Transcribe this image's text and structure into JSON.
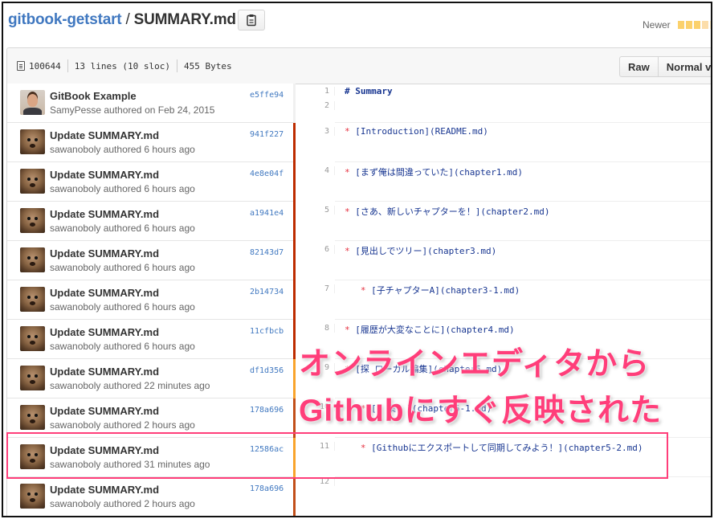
{
  "header": {
    "repo": "gitbook-getstart",
    "sep": " / ",
    "file": "SUMMARY.md",
    "newer": "Newer",
    "legend_colors": [
      "#fbd16c",
      "#fbd16c",
      "#fbd16c",
      "#fcddaa",
      "#fff0cc"
    ]
  },
  "filebar": {
    "mode": "100644",
    "lines": "13 lines (10 sloc)",
    "size": "455 Bytes",
    "raw_label": "Raw",
    "normal_label": "Normal view"
  },
  "commits": [
    {
      "msg": "GitBook Example",
      "author": "SamyPesse authored on Feb 24, 2015",
      "sha": "e5ffe94",
      "avatar": "person",
      "age_color": "#f0f0f0"
    },
    {
      "msg": "Update SUMMARY.md",
      "author": "sawanoboly authored 6 hours ago",
      "sha": "941f227",
      "avatar": "dog",
      "age_color": "#bd2c00"
    },
    {
      "msg": "Update SUMMARY.md",
      "author": "sawanoboly authored 6 hours ago",
      "sha": "4e8e04f",
      "avatar": "dog",
      "age_color": "#bd2c00"
    },
    {
      "msg": "Update SUMMARY.md",
      "author": "sawanoboly authored 6 hours ago",
      "sha": "a1941e4",
      "avatar": "dog",
      "age_color": "#bd2c00"
    },
    {
      "msg": "Update SUMMARY.md",
      "author": "sawanoboly authored 6 hours ago",
      "sha": "82143d7",
      "avatar": "dog",
      "age_color": "#bd2c00"
    },
    {
      "msg": "Update SUMMARY.md",
      "author": "sawanoboly authored 6 hours ago",
      "sha": "2b14734",
      "avatar": "dog",
      "age_color": "#bd2c00"
    },
    {
      "msg": "Update SUMMARY.md",
      "author": "sawanoboly authored 6 hours ago",
      "sha": "11cfbcb",
      "avatar": "dog",
      "age_color": "#bd2c00"
    },
    {
      "msg": "Update SUMMARY.md",
      "author": "sawanoboly authored 22 minutes ago",
      "sha": "df1d356",
      "avatar": "dog",
      "age_color": "#f9a42c"
    },
    {
      "msg": "Update SUMMARY.md",
      "author": "sawanoboly authored 2 hours ago",
      "sha": "178a696",
      "avatar": "dog",
      "age_color": "#c24f1a"
    },
    {
      "msg": "Update SUMMARY.md",
      "author": "sawanoboly authored 31 minutes ago",
      "sha": "12586ac",
      "avatar": "dog",
      "age_color": "#f9a42c"
    },
    {
      "msg": "Update SUMMARY.md",
      "author": "sawanoboly authored 2 hours ago",
      "sha": "178a696",
      "avatar": "dog",
      "age_color": "#c24f1a"
    }
  ],
  "lines": [
    {
      "n": "1",
      "text": "# Summary",
      "kind": "heading"
    },
    {
      "n": "2",
      "text": "",
      "kind": "plain"
    },
    {
      "n": "3",
      "text": "[Introduction](README.md)",
      "kind": "item"
    },
    {
      "n": "4",
      "text": "[まず俺は間違っていた](chapter1.md)",
      "kind": "item"
    },
    {
      "n": "5",
      "text": "[さあ、新しいチャプターを！](chapter2.md)",
      "kind": "item"
    },
    {
      "n": "6",
      "text": "[見出しでツリー](chapter3.md)",
      "kind": "item"
    },
    {
      "n": "7",
      "text": "[子チャプターA](chapter3-1.md)",
      "kind": "subitem"
    },
    {
      "n": "8",
      "text": "[履歴が大変なことに](chapter4.md)",
      "kind": "item"
    },
    {
      "n": "9",
      "text": "[探 ローカル編集](chapter5.md)",
      "kind": "item"
    },
    {
      "n": "10",
      "text": "[  集  ](chapter5-1.md)",
      "kind": "subitem"
    },
    {
      "n": "11",
      "text": "[Githubにエクスポートして同期してみよう！](chapter5-2.md)",
      "kind": "subitem"
    },
    {
      "n": "12",
      "text": "",
      "kind": "plain"
    }
  ],
  "annotation": {
    "line1": "オンラインエディタから",
    "line2": "Githubにすぐ反映された",
    "color": "#ff3e7a"
  }
}
